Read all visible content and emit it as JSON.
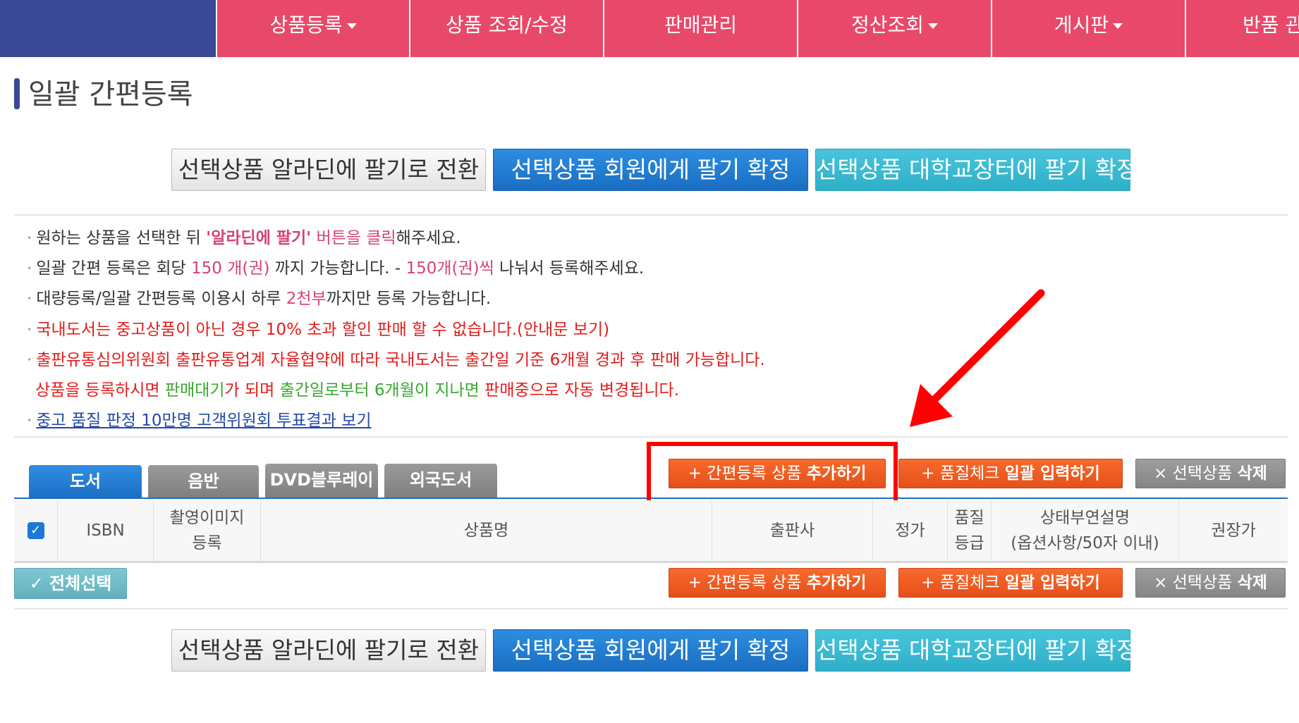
{
  "nav": {
    "items": [
      {
        "label": "상품등록",
        "dropdown": true
      },
      {
        "label": "상품 조회/수정",
        "dropdown": false
      },
      {
        "label": "판매관리",
        "dropdown": false
      },
      {
        "label": "정산조회",
        "dropdown": true
      },
      {
        "label": "게시판",
        "dropdown": true
      },
      {
        "label": "반품 관",
        "dropdown": false
      }
    ]
  },
  "page_title": "일괄 간편등록",
  "action_buttons": {
    "convert_aladin": "선택상품 알라딘에 팔기로 전환",
    "confirm_member": "선택상품 회원에게 팔기 확정",
    "confirm_campus": "선택상품 대학교장터에 팔기 확정"
  },
  "notices": {
    "n1": {
      "a": "원하는 상품을 선택한 뒤 ",
      "b": "'알라딘에 팔기'",
      "c": " 버튼을 클릭",
      "d": "해주세요."
    },
    "n2": {
      "a": "일괄 간편 등록은 회당 ",
      "b": "150 개(권)",
      "c": " 까지 가능합니다. - ",
      "d": "150개(권)씩",
      "e": " 나눠서 등록해주세요."
    },
    "n3": {
      "a": "대량등록/일괄 간편등록 이용시 하루 ",
      "b": "2천부",
      "c": "까지만 등록 가능합니다."
    },
    "n4": "국내도서는 중고상품이 아닌 경우 10% 초과 할인 판매 할 수 없습니다.(안내문 보기)",
    "n5": "출판유통심의위원회 출판유통업계 자율협약에 따라 국내도서는 출간일 기준 6개월 경과 후 판매 가능합니다.",
    "n6": {
      "a": "상품을 등록하시면 ",
      "b": "판매대기",
      "c": "가 되며 ",
      "d": "출간일로부터 6개월이 지나면",
      "e": " 판매중으로 자동 변경됩니다."
    },
    "n7": "중고 품질 판정 10만명 고객위원회 투표결과 보기"
  },
  "tabs": [
    "도서",
    "음반",
    "DVD블루레이",
    "외국도서"
  ],
  "toolbar": {
    "add_prefix": "+ 간편등록 상품 ",
    "add_bold": "추가하기",
    "quality_prefix": "+ 품질체크 ",
    "quality_bold": "일괄 입력하기",
    "delete_prefix": "× 선택상품 ",
    "delete_bold": "삭제"
  },
  "table": {
    "headers": {
      "isbn": "ISBN",
      "photo_l1": "촬영이미지",
      "photo_l2": "등록",
      "name": "상품명",
      "publisher": "출판사",
      "price": "정가",
      "grade_l1": "품질",
      "grade_l2": "등급",
      "desc_l1": "상태부연설명",
      "desc_l2": "(옵션사항/50자 이내)",
      "recommended": "권장가"
    }
  },
  "select_all": "✓ 전체선택",
  "colors": {
    "nav_pink": "#e8496a",
    "nav_navy": "#3b4898",
    "primary_blue": "#1b6fc4",
    "orange": "#e5501a",
    "annotation_red": "#ff0000"
  }
}
